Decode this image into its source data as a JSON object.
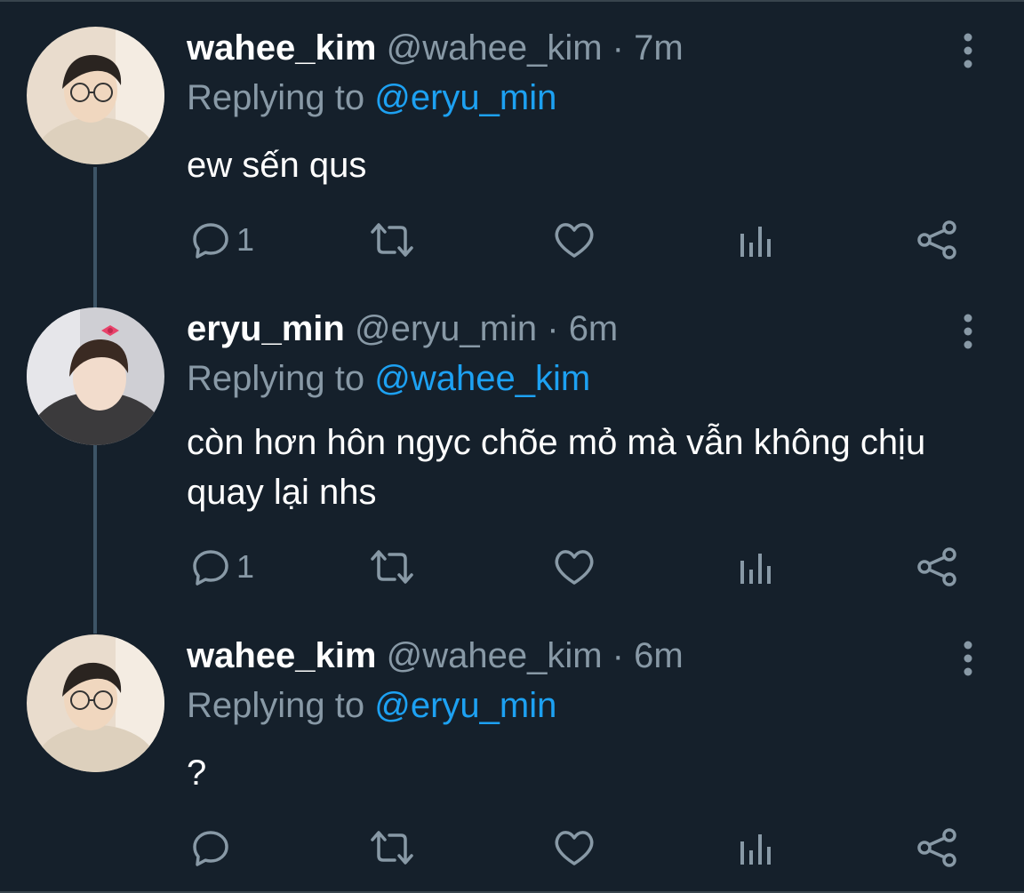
{
  "thread": [
    {
      "display_name": "wahee_kim",
      "handle": "@wahee_kim",
      "separator": "·",
      "time": "7m",
      "replying_prefix": "Replying to",
      "replying_to": "@eryu_min",
      "text": "ew sến qus",
      "reply_count": "1",
      "icons": [
        "reply-icon",
        "retweet-icon",
        "like-icon",
        "analytics-icon",
        "share-icon",
        "more-icon"
      ]
    },
    {
      "display_name": "eryu_min",
      "handle": "@eryu_min",
      "separator": "·",
      "time": "6m",
      "replying_prefix": "Replying to",
      "replying_to": "@wahee_kim",
      "text": "còn hơn hôn ngyc chõe mỏ mà vẫn không chịu quay lại nhs",
      "reply_count": "1",
      "icons": [
        "reply-icon",
        "retweet-icon",
        "like-icon",
        "analytics-icon",
        "share-icon",
        "more-icon"
      ]
    },
    {
      "display_name": "wahee_kim",
      "handle": "@wahee_kim",
      "separator": "·",
      "time": "6m",
      "replying_prefix": "Replying to",
      "replying_to": "@eryu_min",
      "text": "?",
      "reply_count": "",
      "icons": [
        "reply-icon",
        "retweet-icon",
        "like-icon",
        "analytics-icon",
        "share-icon",
        "more-icon"
      ]
    }
  ],
  "colors": {
    "background": "#15202b",
    "primary_text": "#ffffff",
    "secondary_text": "#8899a6",
    "mention": "#1da1f2",
    "thread_line": "#3d5466"
  }
}
